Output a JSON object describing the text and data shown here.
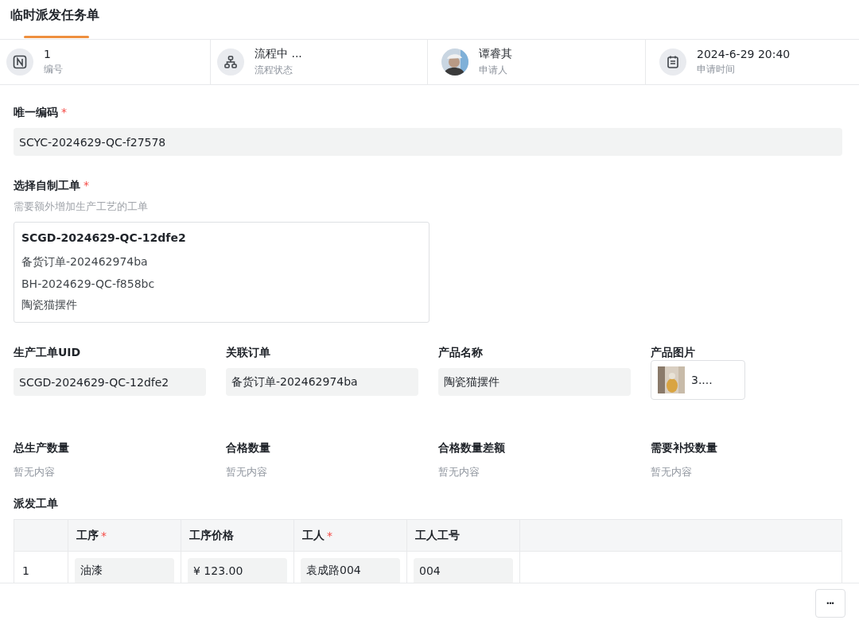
{
  "tab": {
    "label": "临时派发任务单",
    "selected": true
  },
  "summary": [
    {
      "kind": "number",
      "value": "1",
      "label": "编号"
    },
    {
      "kind": "flow",
      "value": "流程中 ...",
      "label": "流程状态"
    },
    {
      "kind": "avatar",
      "value": "谭睿其",
      "label": "申请人"
    },
    {
      "kind": "calendar",
      "value": "2024-6-29 20:40",
      "label": "申请时间"
    }
  ],
  "unique_code": {
    "label": "唯一编码",
    "required": true,
    "value": "SCYC-2024629-QC-f27578"
  },
  "work_order_select": {
    "label": "选择自制工单",
    "required": true,
    "hint": "需要额外增加生产工艺的工单",
    "card_title": "SCGD-2024629-QC-12dfe2",
    "card_lines": [
      "备货订单-202462974ba",
      "BH-2024629-QC-f858bc",
      "陶瓷猫摆件"
    ]
  },
  "fields": [
    {
      "kind": "text",
      "label": "生产工单UID",
      "value": "SCGD-2024629-QC-12dfe2"
    },
    {
      "kind": "text",
      "label": "关联订单",
      "value": "备货订单-202462974ba"
    },
    {
      "kind": "text",
      "label": "产品名称",
      "value": "陶瓷猫摆件"
    },
    {
      "label": "产品图片",
      "value": "3...."
    }
  ],
  "quantities": [
    {
      "label": "总生产数量",
      "value": "暂无内容"
    },
    {
      "label": "合格数量",
      "value": "暂无内容"
    },
    {
      "label": "合格数量差额",
      "value": "暂无内容"
    },
    {
      "label": "需要补投数量",
      "value": "暂无内容"
    }
  ],
  "dispatch_table": {
    "title": "派发工单",
    "columns": [
      {
        "label": "工序",
        "required": true
      },
      {
        "label": "工序价格",
        "required": false
      },
      {
        "label": "工人",
        "required": true
      },
      {
        "label": "工人工号",
        "required": false
      }
    ],
    "rows": [
      {
        "index": "1",
        "cells": [
          "油漆",
          "¥ 123.00",
          "袁成路004",
          "004"
        ]
      }
    ]
  },
  "required_mark": "*",
  "more_button": "•••"
}
